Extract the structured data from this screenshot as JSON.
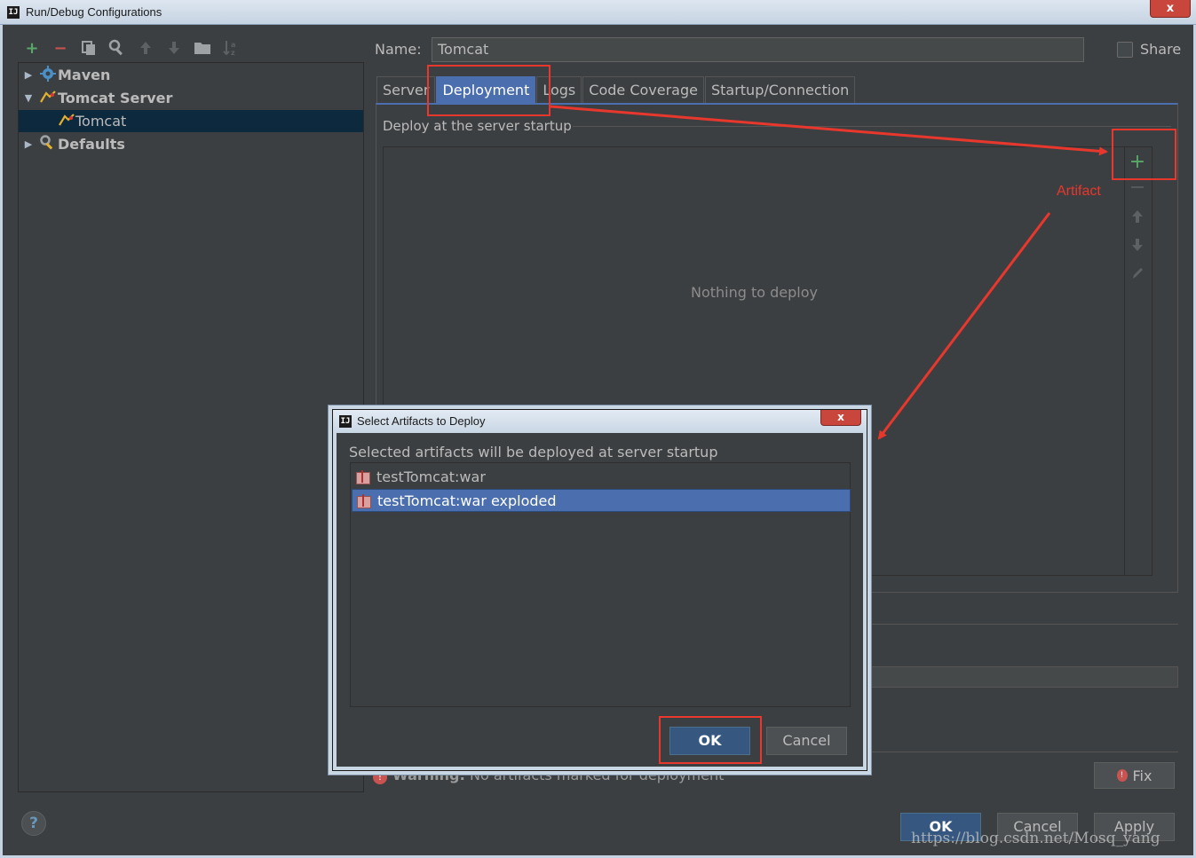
{
  "window": {
    "title": "Run/Debug Configurations",
    "app_icon_text": "IJ",
    "close_glyph": "x"
  },
  "toolbar": {
    "items": [
      "add-icon",
      "remove-icon",
      "copy-icon",
      "settings-icon",
      "move-up-icon",
      "move-down-icon",
      "folder-icon",
      "sort-icon"
    ]
  },
  "tree": {
    "items": [
      {
        "label": "Maven",
        "expanded": false,
        "bold": true,
        "icon": "maven-gear-icon"
      },
      {
        "label": "Tomcat Server",
        "expanded": true,
        "bold": true,
        "icon": "tomcat-icon"
      },
      {
        "label": "Tomcat",
        "selected": true,
        "bold": false,
        "icon": "tomcat-icon"
      },
      {
        "label": "Defaults",
        "expanded": false,
        "bold": true,
        "icon": "wrench-icon"
      }
    ]
  },
  "config": {
    "name_label": "Name:",
    "name_value": "Tomcat",
    "share_label": "Share",
    "share_checked": false
  },
  "tabs": [
    "Server",
    "Deployment",
    "Logs",
    "Code Coverage",
    "Startup/Connection"
  ],
  "active_tab": "Deployment",
  "deployment": {
    "section_title": "Deploy at the server startup",
    "empty_text": "Nothing to deploy",
    "side_tools": [
      "add-icon",
      "remove-icon",
      "move-up-icon",
      "move-down-icon",
      "edit-icon"
    ]
  },
  "warning": {
    "bold": "Warning:",
    "text": " No artifacts marked for deployment"
  },
  "fix_label": "Fix",
  "buttons": {
    "help": "?",
    "ok": "OK",
    "cancel": "Cancel",
    "apply": "Apply"
  },
  "dialog": {
    "title": "Select Artifacts to Deploy",
    "description": "Selected artifacts will be deployed at server startup",
    "artifacts": [
      "testTomcat:war",
      "testTomcat:war exploded"
    ],
    "selected_artifact": "testTomcat:war exploded",
    "ok": "OK",
    "cancel": "Cancel"
  },
  "annotation": {
    "label": "Artifact",
    "color": "#e8372c"
  },
  "watermark": "https://blog.csdn.net/Mosq_yang",
  "colors": {
    "background": "#3c3f41",
    "selection": "#4b6eaf",
    "tree_selection": "#0d293e",
    "primary_button": "#365880"
  }
}
